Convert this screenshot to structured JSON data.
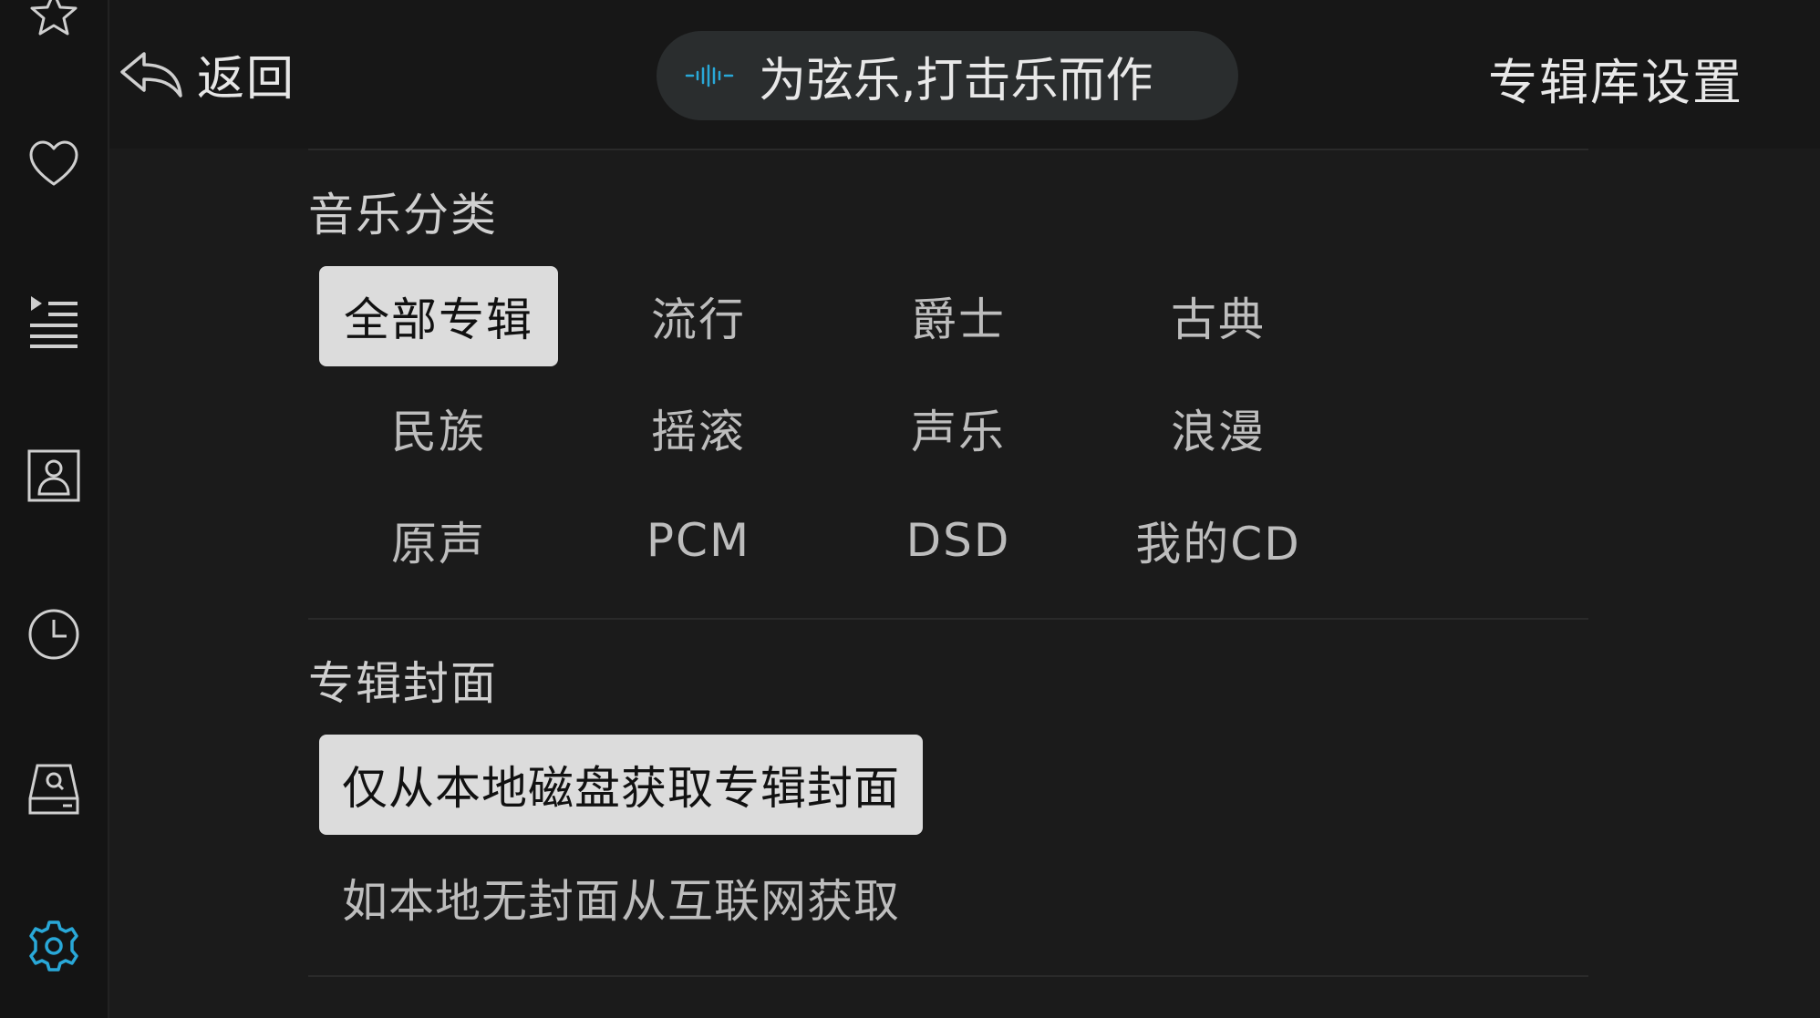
{
  "sidebar": {
    "items": [
      {
        "name": "favorites-star"
      },
      {
        "name": "liked"
      },
      {
        "name": "playlist"
      },
      {
        "name": "artist"
      },
      {
        "name": "recent"
      },
      {
        "name": "storage"
      },
      {
        "name": "settings",
        "active": true
      }
    ],
    "accent_color": "#29a8d8"
  },
  "header": {
    "back_label": "返回",
    "now_playing": "为弦乐,打击乐而作",
    "title": "专辑库设置"
  },
  "music_category": {
    "title": "音乐分类",
    "options": [
      {
        "label": "全部专辑",
        "selected": true
      },
      {
        "label": "流行",
        "selected": false
      },
      {
        "label": "爵士",
        "selected": false
      },
      {
        "label": "古典",
        "selected": false
      },
      {
        "label": "民族",
        "selected": false
      },
      {
        "label": "摇滚",
        "selected": false
      },
      {
        "label": "声乐",
        "selected": false
      },
      {
        "label": "浪漫",
        "selected": false
      },
      {
        "label": "原声",
        "selected": false
      },
      {
        "label": "PCM",
        "selected": false
      },
      {
        "label": "DSD",
        "selected": false
      },
      {
        "label": "我的CD",
        "selected": false
      }
    ]
  },
  "album_cover": {
    "title": "专辑封面",
    "options": [
      {
        "label": "仅从本地磁盘获取专辑封面",
        "selected": true
      },
      {
        "label": "如本地无封面从互联网获取",
        "selected": false
      }
    ]
  }
}
